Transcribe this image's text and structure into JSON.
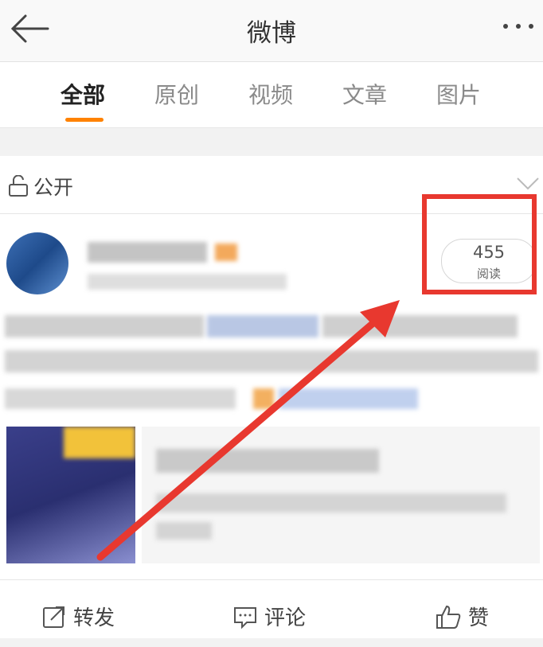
{
  "header": {
    "title": "微博"
  },
  "tabs": [
    {
      "label": "全部"
    },
    {
      "label": "原创"
    },
    {
      "label": "视频"
    },
    {
      "label": "文章"
    },
    {
      "label": "图片"
    }
  ],
  "post": {
    "visibility": "公开",
    "read_count": "455",
    "read_label": "阅读"
  },
  "actions": {
    "repost": "转发",
    "comment": "评论",
    "like": "赞"
  },
  "colors": {
    "accent": "#ff8200",
    "highlight": "#e8382f"
  }
}
